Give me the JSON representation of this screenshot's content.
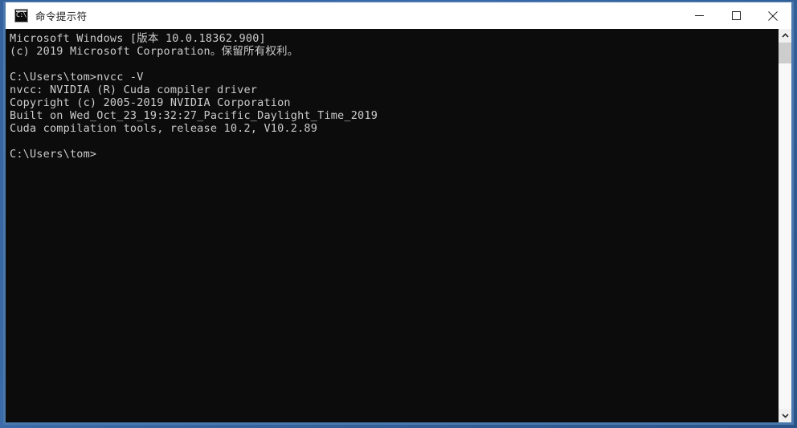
{
  "window": {
    "title": "命令提示符",
    "icon": "cmd-console-icon",
    "icon_glyph": "C:\\.",
    "border_color": "#4a78ad",
    "titlebar_bg": "#ffffff",
    "terminal_bg": "#0c0c0c",
    "terminal_fg": "#cccccc"
  },
  "controls": {
    "minimize": "minimize-icon",
    "maximize": "maximize-icon",
    "close": "close-icon"
  },
  "terminal": {
    "lines": [
      "Microsoft Windows [版本 10.0.18362.900]",
      "(c) 2019 Microsoft Corporation。保留所有权利。",
      "",
      "C:\\Users\\tom>nvcc -V",
      "nvcc: NVIDIA (R) Cuda compiler driver",
      "Copyright (c) 2005-2019 NVIDIA Corporation",
      "Built on Wed_Oct_23_19:32:27_Pacific_Daylight_Time_2019",
      "Cuda compilation tools, release 10.2, V10.2.89",
      "",
      "C:\\Users\\tom>"
    ]
  },
  "scrollbar": {
    "up_arrow": "chevron-up-icon",
    "down_arrow": "chevron-down-icon",
    "thumb_position_percent": 0,
    "thumb_size_percent": 6
  }
}
